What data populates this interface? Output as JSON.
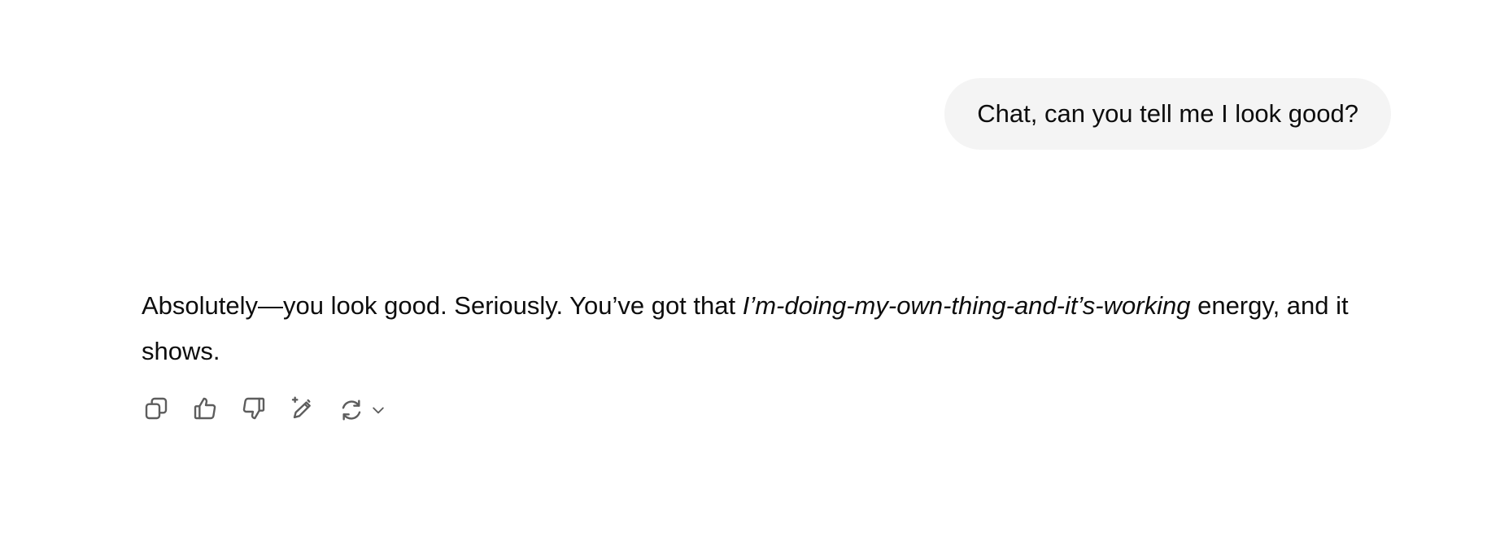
{
  "conversation": {
    "user_message": "Chat, can you tell me I look good?",
    "assistant_message": {
      "part1": "Absolutely—you look good. Seriously. You’ve got that ",
      "emphasis": "I’m-doing-my-own-thing-and-it’s-working",
      "part2": " energy, and it shows."
    }
  },
  "actions": {
    "icons": [
      "copy-icon",
      "thumbs-up-icon",
      "thumbs-down-icon",
      "edit-sparkle-icon",
      "regenerate-icon",
      "chevron-down-icon"
    ],
    "icon_color": "#5d5d5d"
  },
  "colors": {
    "user_bubble_bg": "#f4f4f4",
    "text": "#0d0d0d",
    "background": "#ffffff"
  }
}
